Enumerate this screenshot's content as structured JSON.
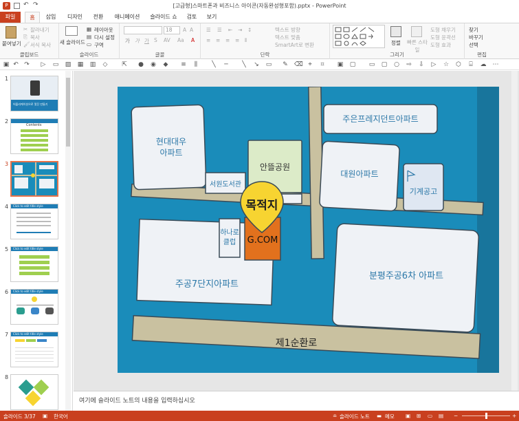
{
  "window": {
    "title": "[고급형]스마트폰과 비즈니스 아이콘(자동완성형포함).pptx - PowerPoint"
  },
  "tabs": [
    "파일",
    "홈",
    "삽입",
    "디자인",
    "전환",
    "애니메이션",
    "슬라이드 쇼",
    "검토",
    "보기"
  ],
  "ribbon": {
    "clipboard": {
      "label": "클립보드",
      "paste": "붙여넣기",
      "cut": "잘라내기",
      "copy": "복사",
      "format_painter": "서식 복사"
    },
    "slides": {
      "label": "슬라이드",
      "new_slide": "새 슬라이드",
      "layout": "레이아웃",
      "reset": "다시 설정",
      "section": "구역"
    },
    "font": {
      "label": "글꼴",
      "size": "18"
    },
    "paragraph": {
      "label": "단락",
      "text_direction": "텍스트 방향",
      "align_text": "텍스트 맞춤",
      "smartart": "SmartArt로 변환"
    },
    "drawing": {
      "label": "그리기",
      "arrange": "정렬",
      "quick_styles": "빠른 스타일",
      "fill": "도형 채우기",
      "outline": "도형 윤곽선",
      "effects": "도형 효과"
    },
    "editing": {
      "label": "편집",
      "find": "찾기",
      "replace": "바꾸기",
      "select": "선택"
    }
  },
  "thumbnails": [
    {
      "num": "1",
      "title": "어플리케이션으로 멋진 만들기"
    },
    {
      "num": "2",
      "title": "Contents"
    },
    {
      "num": "3",
      "title": ""
    },
    {
      "num": "4",
      "title": "Click to edit title style"
    },
    {
      "num": "5",
      "title": "Click to edit title style"
    },
    {
      "num": "6",
      "title": "Click to edit title style"
    },
    {
      "num": "7",
      "title": "Click to edit title style"
    },
    {
      "num": "8",
      "title": ""
    }
  ],
  "slide": {
    "buildings": {
      "hyundai": "현대대우\n아파트",
      "juen": "주은프레지던트아파트",
      "park": "안뜰공원",
      "library": "서원도서관",
      "daewon": "대원아파트",
      "machine": "기계공고",
      "hanaro": "하나로\n클럽",
      "gcom": "G.COM",
      "jugong7": "주공7단지아파트",
      "bunpyeong": "분평주공6차 아파트",
      "ring_road": "제1순환로"
    },
    "pin": "목적지",
    "colors": {
      "bg": "#1a8cba",
      "road": "#c9c1a0",
      "block": "#eff2f6",
      "park": "#dcebc8",
      "gcom": "#e2711d",
      "pin": "#f7d431",
      "text": "#2c78a8"
    }
  },
  "notes": {
    "placeholder": "여기에 슬라이드 노트의 내용을 입력하십시오"
  },
  "status": {
    "slide": "슬라이드 3/37",
    "language": "한국어",
    "notes": "슬라이드 노트",
    "comments": "메모"
  }
}
